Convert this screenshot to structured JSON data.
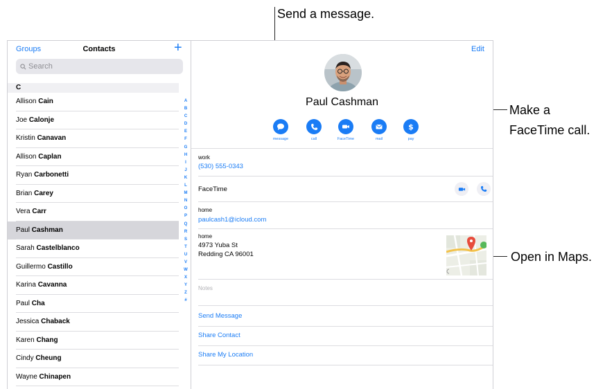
{
  "sidebar": {
    "groups_label": "Groups",
    "title": "Contacts",
    "add_label": "+",
    "search_placeholder": "Search",
    "section_letter": "C",
    "contacts": [
      {
        "first": "Allison",
        "last": "Cain"
      },
      {
        "first": "Joe",
        "last": "Calonje"
      },
      {
        "first": "Kristin",
        "last": "Canavan"
      },
      {
        "first": "Allison",
        "last": "Caplan"
      },
      {
        "first": "Ryan",
        "last": "Carbonetti"
      },
      {
        "first": "Brian",
        "last": "Carey"
      },
      {
        "first": "Vera",
        "last": "Carr"
      },
      {
        "first": "Paul",
        "last": "Cashman"
      },
      {
        "first": "Sarah",
        "last": "Castelblanco"
      },
      {
        "first": "Guillermo",
        "last": "Castillo"
      },
      {
        "first": "Karina",
        "last": "Cavanna"
      },
      {
        "first": "Paul",
        "last": "Cha"
      },
      {
        "first": "Jessica",
        "last": "Chaback"
      },
      {
        "first": "Karen",
        "last": "Chang"
      },
      {
        "first": "Cindy",
        "last": "Cheung"
      },
      {
        "first": "Wayne",
        "last": "Chinapen"
      }
    ],
    "selected_index": 7,
    "index_letters": [
      "A",
      "B",
      "C",
      "D",
      "E",
      "F",
      "G",
      "H",
      "I",
      "J",
      "K",
      "L",
      "M",
      "N",
      "O",
      "P",
      "Q",
      "R",
      "S",
      "T",
      "U",
      "V",
      "W",
      "X",
      "Y",
      "Z",
      "#"
    ]
  },
  "detail": {
    "edit_label": "Edit",
    "name": "Paul Cashman",
    "actions": [
      {
        "label": "message",
        "icon": "message-icon"
      },
      {
        "label": "call",
        "icon": "phone-icon"
      },
      {
        "label": "FaceTime",
        "icon": "video-icon"
      },
      {
        "label": "mail",
        "icon": "mail-icon"
      },
      {
        "label": "pay",
        "icon": "dollar-icon"
      }
    ],
    "phone_label": "work",
    "phone_value": "(530) 555-0343",
    "facetime_label": "FaceTime",
    "email_label": "home",
    "email_value": "paulcash1@icloud.com",
    "address_label": "home",
    "address_line1": "4973 Yuba St",
    "address_line2": "Redding CA 96001",
    "notes_label": "Notes",
    "links": [
      "Send Message",
      "Share Contact",
      "Share My Location"
    ]
  },
  "callouts": {
    "message": "Send a message.",
    "facetime_line1": "Make a",
    "facetime_line2": "FaceTime call.",
    "maps": "Open in Maps."
  },
  "colors": {
    "accent": "#1a7cf5",
    "selected_row": "#d6d6db",
    "separator": "#dcdce0"
  }
}
